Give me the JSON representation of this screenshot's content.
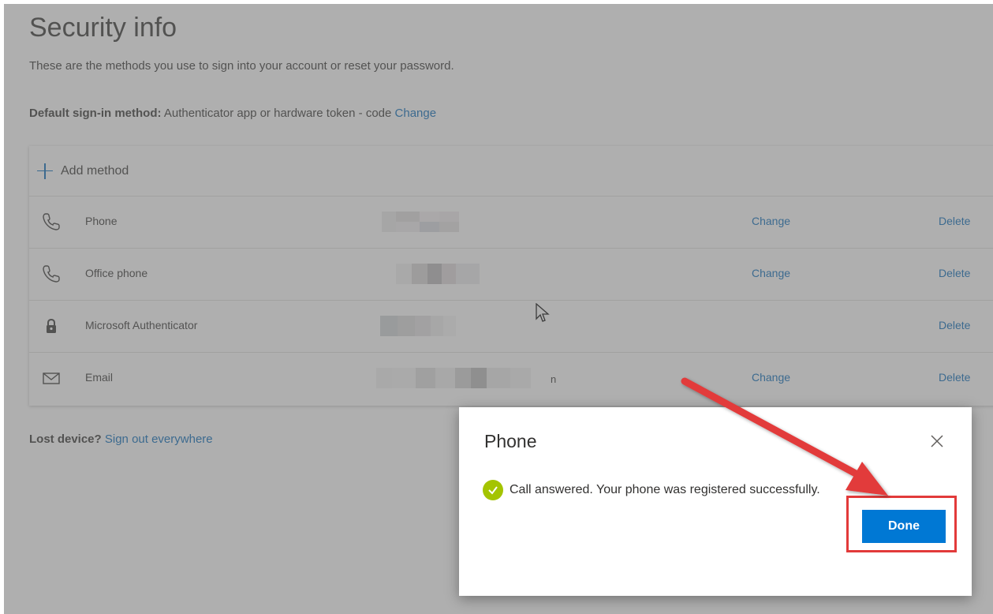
{
  "page": {
    "title": "Security info",
    "description": "These are the methods you use to sign into your account or reset your password.",
    "default_method_label": "Default sign-in method:",
    "default_method_value": "Authenticator app or hardware token - code",
    "default_method_change": "Change"
  },
  "methods": {
    "add_label": "Add method",
    "change_label": "Change",
    "delete_label": "Delete",
    "items": [
      {
        "name": "Phone",
        "icon": "phone-icon"
      },
      {
        "name": "Office phone",
        "icon": "phone-icon"
      },
      {
        "name": "Microsoft Authenticator",
        "icon": "lock-icon"
      },
      {
        "name": "Email",
        "icon": "mail-icon",
        "tail": "n"
      }
    ]
  },
  "lost_device": {
    "label": "Lost device?",
    "link": "Sign out everywhere"
  },
  "dialog": {
    "title": "Phone",
    "message": "Call answered. Your phone was registered successfully.",
    "done_label": "Done",
    "close_icon": "close-icon",
    "status_icon": "check-icon"
  },
  "colors": {
    "link": "#0067b8",
    "primary_button": "#0078d4",
    "success": "#a4c400",
    "annotation": "#e23a3a"
  }
}
